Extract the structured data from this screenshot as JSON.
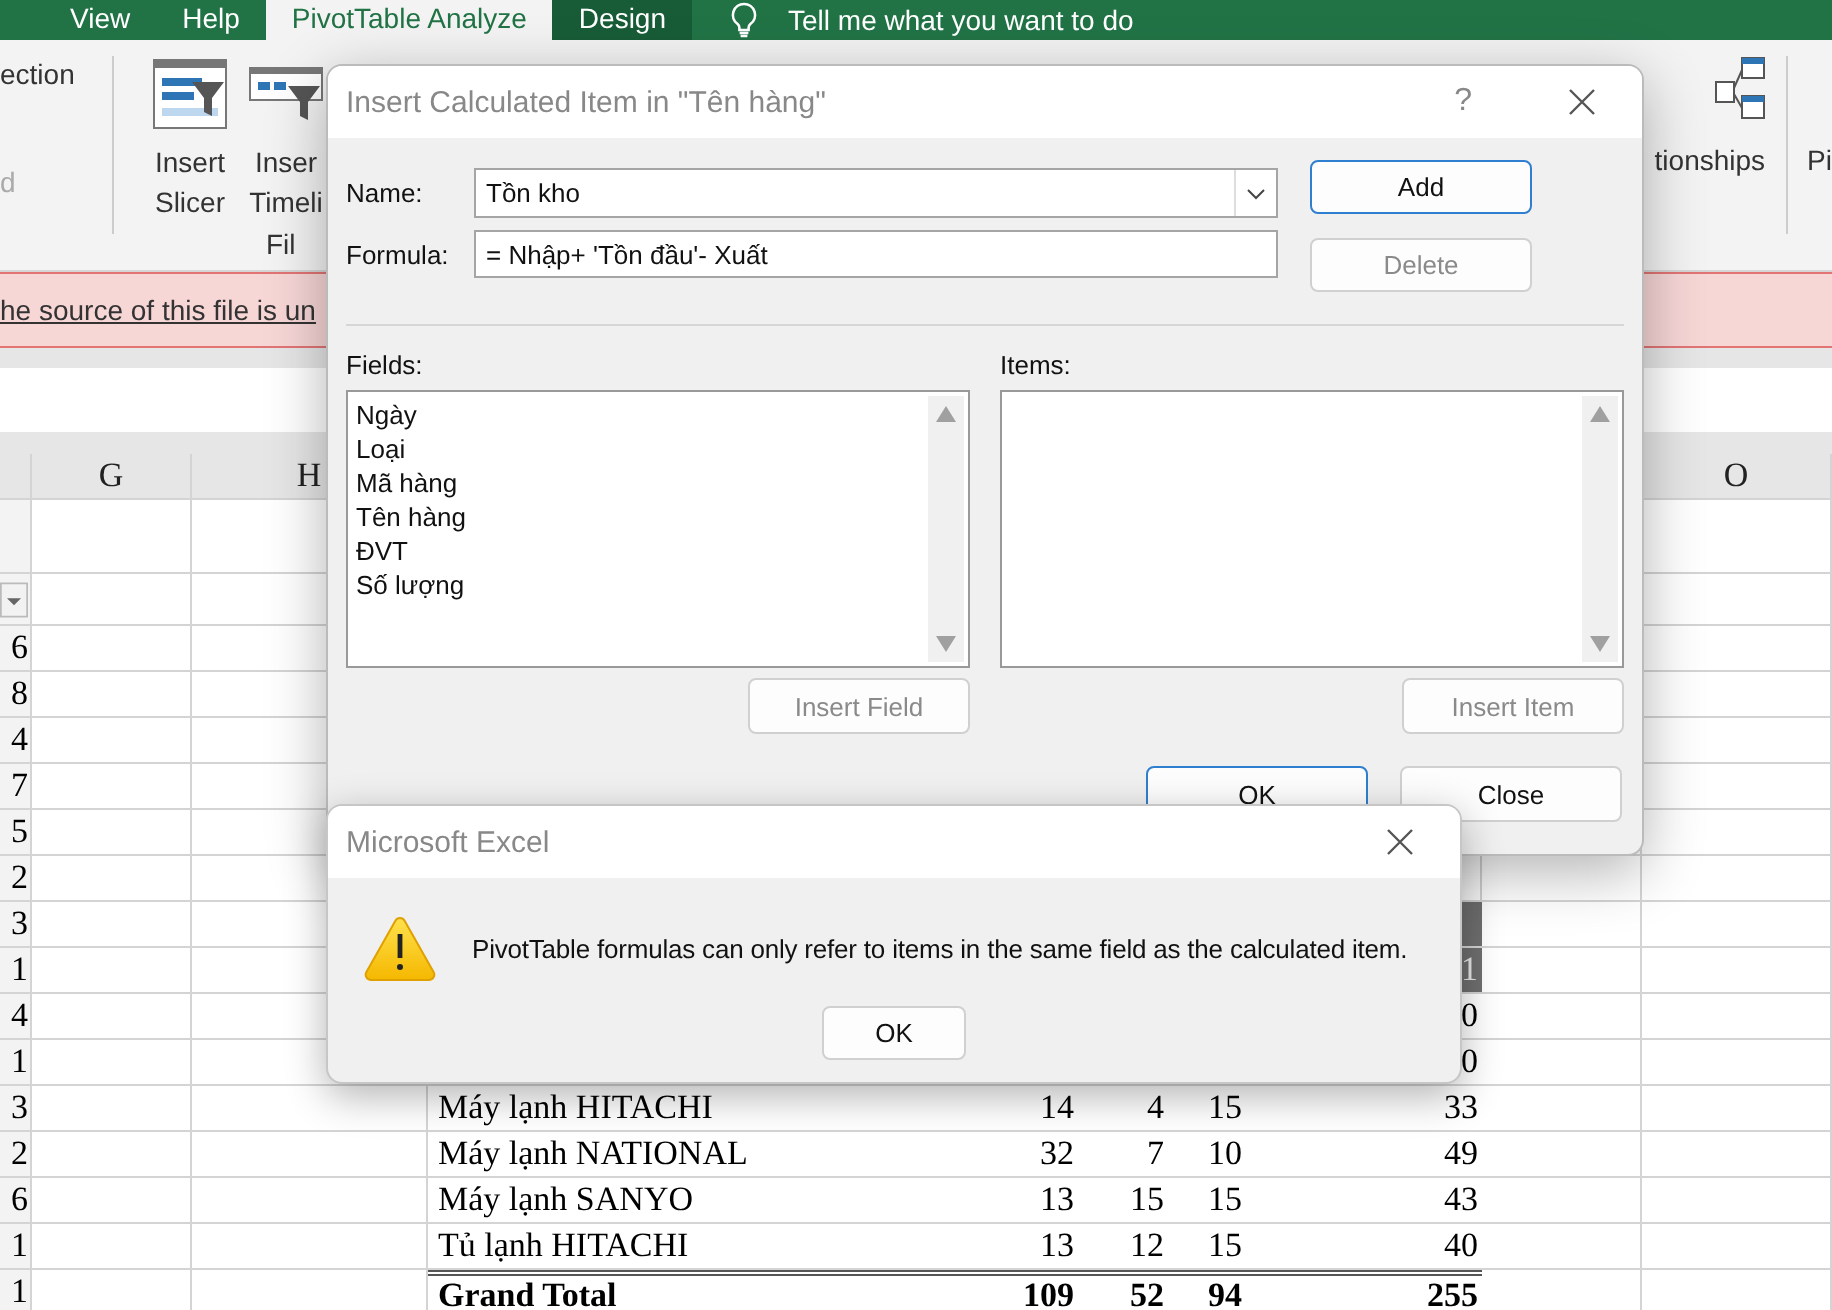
{
  "ribbon": {
    "tabs": [
      {
        "label": "View",
        "selected": false,
        "kind": "standard"
      },
      {
        "label": "Help",
        "selected": false,
        "kind": "standard"
      },
      {
        "label": "PivotTable Analyze",
        "selected": true,
        "kind": "contextual"
      },
      {
        "label": "Design",
        "selected": false,
        "kind": "contextual"
      }
    ],
    "tell_me": "Tell me what you want to do",
    "left_commands": [
      {
        "label": "ection",
        "disabled": false
      },
      {
        "label": "d",
        "disabled": true
      }
    ],
    "filter_group": {
      "label": "Fil",
      "buttons": [
        {
          "kind": "slicer",
          "lines": [
            "Insert",
            "Slicer"
          ]
        },
        {
          "kind": "timeline",
          "lines": [
            "Inser",
            "Timeli"
          ]
        }
      ]
    },
    "relationships": {
      "label": "tionships"
    },
    "next_command": {
      "label": "Pi"
    }
  },
  "message_bar": {
    "text": "he source of this file is un"
  },
  "sheet": {
    "column_headers": [
      {
        "label": "G"
      },
      {
        "label": "H"
      },
      {
        "label": "O"
      }
    ],
    "column_a": [
      "6",
      "8",
      "4",
      "7",
      "5",
      "2",
      "3",
      "1",
      "4",
      "1",
      "3",
      "2",
      "6",
      "1",
      "1"
    ],
    "pivot_rows": [
      {
        "kind": "header"
      },
      {
        "kind": "header",
        "total": "1"
      },
      {
        "kind": "partial",
        "total": "0"
      },
      {
        "kind": "partial",
        "total": "0"
      },
      {
        "kind": "item",
        "label": "Máy lạnh HITACHI",
        "values": [
          "14",
          "4",
          "15",
          "33"
        ]
      },
      {
        "kind": "item",
        "label": "Máy lạnh NATIONAL",
        "values": [
          "32",
          "7",
          "10",
          "49"
        ]
      },
      {
        "kind": "item",
        "label": "Máy lạnh SANYO",
        "values": [
          "13",
          "15",
          "15",
          "43"
        ]
      },
      {
        "kind": "item",
        "label": "Tủ lạnh HITACHI",
        "values": [
          "13",
          "12",
          "15",
          "40"
        ]
      },
      {
        "kind": "total",
        "label": "Grand Total",
        "values": [
          "109",
          "52",
          "94",
          "255"
        ]
      }
    ]
  },
  "dialog": {
    "title": "Insert Calculated Item in \"Tên hàng\"",
    "help": "?",
    "name_label": "Name:",
    "name_value": "Tồn kho",
    "formula_label": "Formula:",
    "formula_value": "= Nhập+ 'Tồn đầu'- Xuất",
    "side_buttons": [
      {
        "label": "Add",
        "disabled": false,
        "default": true
      },
      {
        "label": "Delete",
        "disabled": true,
        "default": false
      }
    ],
    "fields_label": "Fields:",
    "fields": [
      "Ngày",
      "Loại",
      "Mã hàng",
      "Tên hàng",
      "ĐVT",
      "Số lượng"
    ],
    "insert_field": {
      "label": "Insert Field",
      "disabled": true
    },
    "items_label": "Items:",
    "insert_item": {
      "label": "Insert Item",
      "disabled": true
    },
    "footer_buttons": [
      {
        "label": "OK",
        "disabled": false,
        "default": true
      },
      {
        "label": "Close",
        "disabled": false,
        "default": false
      }
    ]
  },
  "message_box": {
    "title": "Microsoft Excel",
    "text": "PivotTable formulas can only refer to items in the same field as the calculated item.",
    "button": "OK"
  }
}
